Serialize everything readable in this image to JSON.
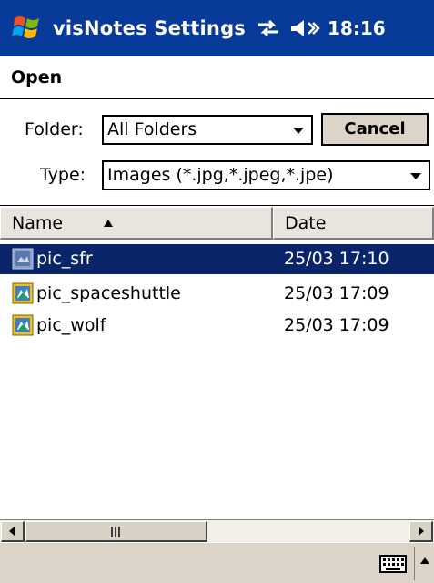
{
  "statusbar": {
    "app_title": "visNotes Settings",
    "time": "18:16",
    "icons": [
      "windows-start-icon",
      "connectivity-icon",
      "volume-icon"
    ]
  },
  "dialog": {
    "title": "Open",
    "folder_label": "Folder:",
    "folder_value": "All Folders",
    "type_label": "Type:",
    "type_value": "Images (*.jpg,*.jpeg,*.jpe)",
    "cancel_label": "Cancel"
  },
  "list": {
    "columns": [
      {
        "label": "Name",
        "sorted": "ascending"
      },
      {
        "label": "Date"
      }
    ],
    "rows": [
      {
        "name": "pic_sfr",
        "date": "25/03 17:10",
        "selected": true
      },
      {
        "name": "pic_spaceshuttle",
        "date": "25/03 17:09",
        "selected": false
      },
      {
        "name": "pic_wolf",
        "date": "25/03 17:09",
        "selected": false
      }
    ]
  },
  "menubar": {
    "icons": [
      "keyboard-icon",
      "sip-arrow-icon"
    ]
  },
  "colors": {
    "titlebar": "#083a9a",
    "selection": "#0a246a",
    "chrome": "#dcd4c8"
  }
}
